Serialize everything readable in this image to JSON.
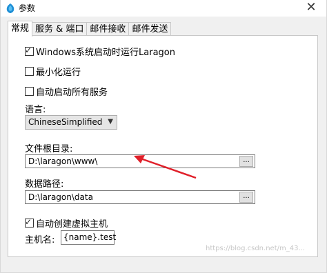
{
  "window": {
    "title": "参数",
    "close_glyph": "✕"
  },
  "tabs": [
    {
      "label": "常规",
      "active": true
    },
    {
      "label": "服务 & 端口",
      "active": false
    },
    {
      "label": "邮件接收",
      "active": false
    },
    {
      "label": "邮件发送",
      "active": false
    }
  ],
  "options": {
    "run_at_startup": {
      "label": "Windows系统启动时运行Laragon",
      "checked": true
    },
    "run_minimized": {
      "label": "最小化运行",
      "checked": false
    },
    "autostart_all": {
      "label": "自动启动所有服务",
      "checked": false
    },
    "auto_create_vhost": {
      "label": "自动创建虚拟主机",
      "checked": true
    }
  },
  "language": {
    "label": "语言:",
    "selected": "ChineseSimplified"
  },
  "document_root": {
    "label": "文件根目录:",
    "value": "D:\\laragon\\www\\",
    "browse_label": "..."
  },
  "data_dir": {
    "label": "数据路径:",
    "value": "D:\\laragon\\data",
    "browse_label": "..."
  },
  "hostname": {
    "label": "主机名:",
    "value": "{name}.test"
  },
  "annotation": {
    "arrow_color": "#e0202a"
  },
  "watermark": "https://blog.csdn.net/m_43..."
}
